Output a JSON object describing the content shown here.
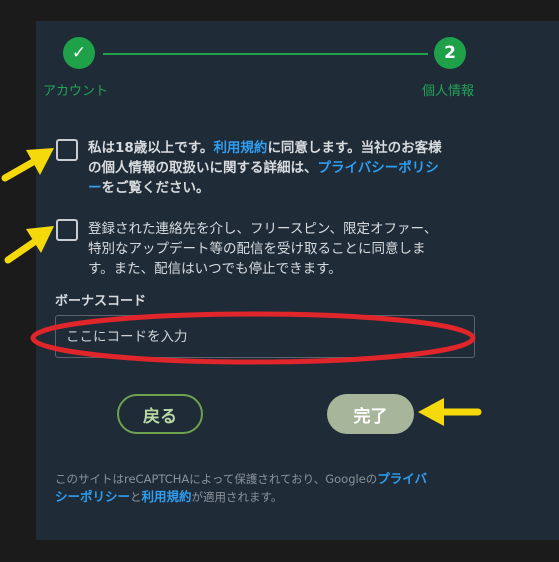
{
  "stepper": {
    "step1_label": "アカウント",
    "step2_number": "2",
    "step2_label": "個人情報"
  },
  "consent1": {
    "bold_text": "私は18歳以上です。",
    "terms_link": "利用規約",
    "text2": "に同意します。当社のお客様",
    "text3": "の個人情報の取扱いに関する詳細は、",
    "privacy_link_a": "プライバシーポリシ",
    "privacy_link_b": "ー",
    "text4": "をご覧ください。"
  },
  "consent2": {
    "line1": "登録された連絡先を介し、フリースピン、限定オファー、",
    "line2": "特別なアップデート等の配信を受け取ることに同意しま",
    "line3": "す。また、配信はいつでも停止できます。"
  },
  "bonus": {
    "label": "ボーナスコード",
    "placeholder": "ここにコードを入力"
  },
  "buttons": {
    "back": "戻る",
    "done": "完了"
  },
  "footer": {
    "text1": "このサイトはreCAPTCHAによって保護されており、Googleの",
    "privacy_a": "プライバ",
    "privacy_b": "シーポリシー",
    "and": "と",
    "terms": "利用規約",
    "text2": "が適用されます。"
  },
  "colors": {
    "accent_green": "#1fa14a",
    "link_blue": "#2f9df0",
    "annotation_yellow": "#f5d90a",
    "annotation_red": "#e0252b"
  }
}
